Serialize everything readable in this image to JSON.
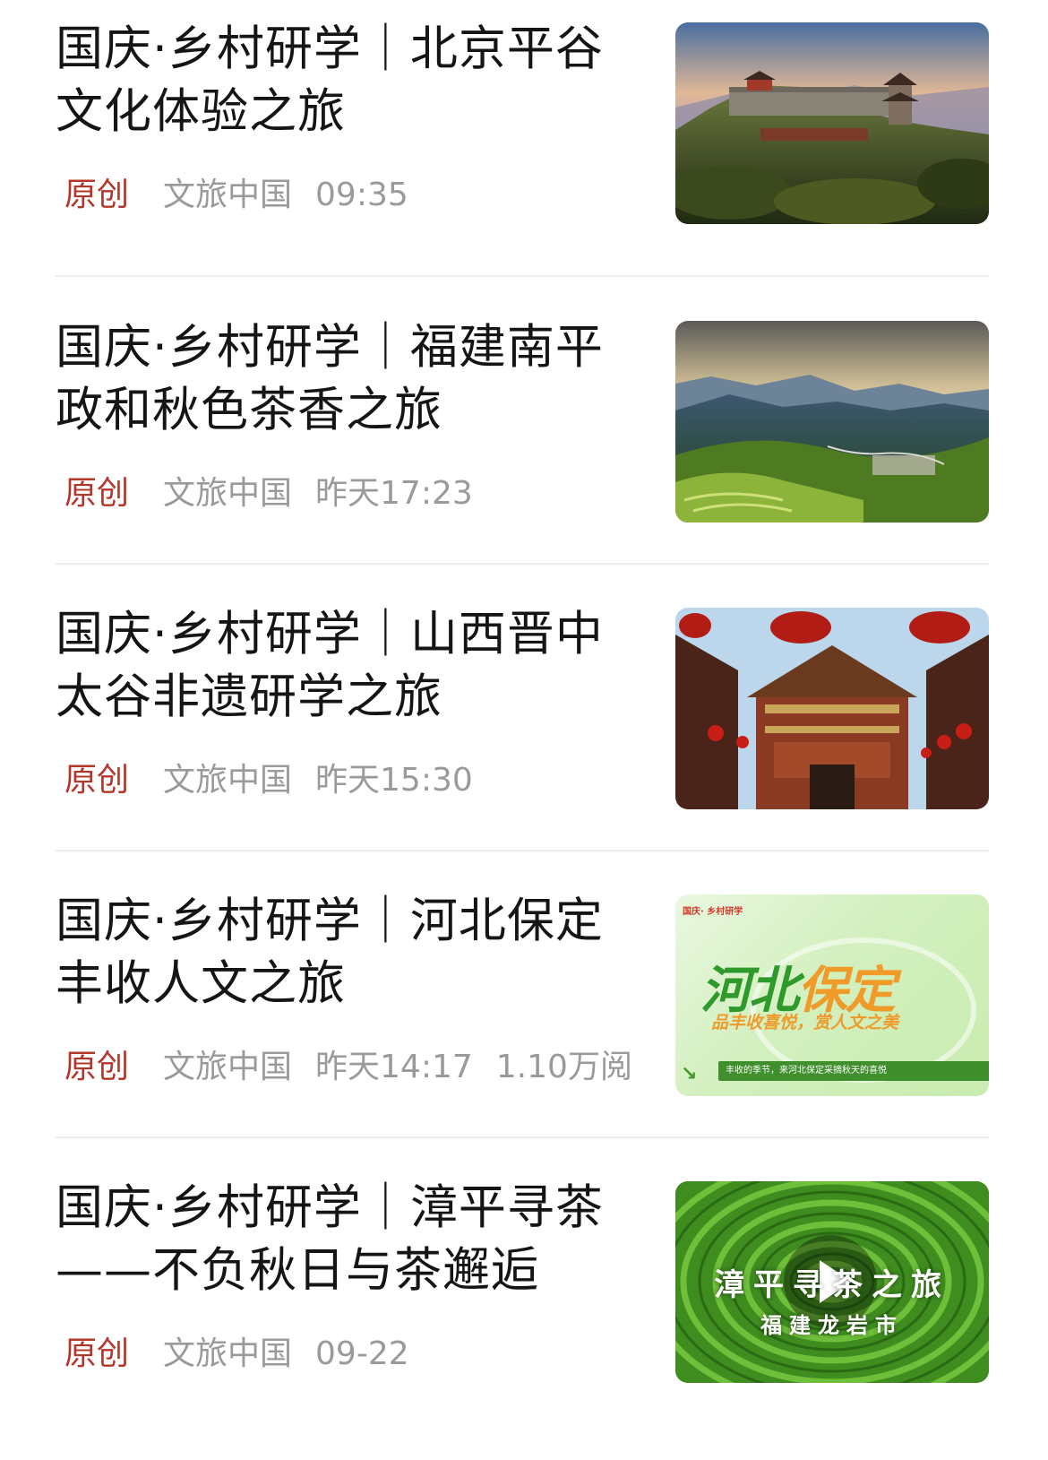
{
  "articles": [
    {
      "title": "国庆·乡村研学｜北京平谷文化体验之旅",
      "badge": "原创",
      "source": "文旅中国",
      "time": "09:35",
      "reads": "",
      "thumb_icon": "mountain-temple-photo"
    },
    {
      "title": "国庆·乡村研学｜福建南平政和秋色茶香之旅",
      "badge": "原创",
      "source": "文旅中国",
      "time": "昨天17:23",
      "reads": "",
      "thumb_icon": "valley-terrace-photo"
    },
    {
      "title": "国庆·乡村研学｜山西晋中太谷非遗研学之旅",
      "badge": "原创",
      "source": "文旅中国",
      "time": "昨天15:30",
      "reads": "",
      "thumb_icon": "lantern-gate-photo"
    },
    {
      "title": "国庆·乡村研学｜河北保定丰收人文之旅",
      "badge": "原创",
      "source": "文旅中国",
      "time": "昨天14:17",
      "reads": "1.10万阅",
      "thumb_icon": "hebei-poster",
      "thumb_text": {
        "tag": "国庆· 乡村研学",
        "main_green": "河北",
        "main_orange": "保定",
        "sub": "品丰收喜悦，赏人文之美",
        "bar": "丰收的季节，来河北保定采摘秋天的喜悦"
      }
    },
    {
      "title": "国庆·乡村研学｜漳平寻茶——不负秋日与茶邂逅",
      "badge": "原创",
      "source": "文旅中国",
      "time": "09-22",
      "reads": "",
      "thumb_icon": "tea-field-video",
      "thumb_text": {
        "line1": "漳平寻茶之旅",
        "line2": "福建龙岩市"
      }
    }
  ],
  "colors": {
    "title": "#151515",
    "badge": "#b5352b",
    "meta": "#9a9a9a",
    "divider": "#eeeeee"
  }
}
